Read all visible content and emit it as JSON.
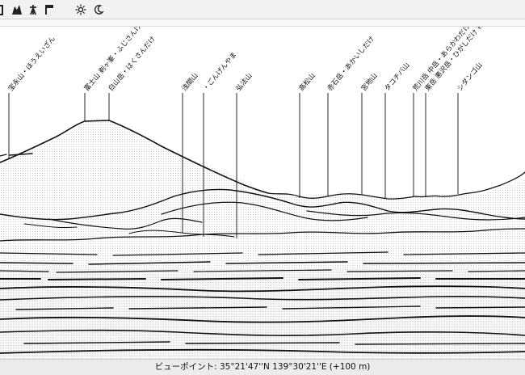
{
  "toolbar": {
    "buttons": [
      {
        "id": "tb-partial",
        "icon": "partial-tool-icon"
      },
      {
        "id": "tb-mountain",
        "icon": "mountain-icon"
      },
      {
        "id": "tb-tower",
        "icon": "tower-icon"
      },
      {
        "id": "tb-flag",
        "icon": "flag-icon"
      },
      {
        "id": "tb-sun",
        "icon": "sun-icon"
      },
      {
        "id": "tb-moon",
        "icon": "moon-icon"
      }
    ]
  },
  "peaks": [
    {
      "name": "宝永山・ほうえいざん"
    },
    {
      "name": "富士山 剣ヶ峯・ふじさんけんがみね"
    },
    {
      "name": "白山岳・はくさんだけ"
    },
    {
      "name": "浅間山"
    },
    {
      "name": "・ごんげんやま"
    },
    {
      "name": "弘法山"
    },
    {
      "name": "高松山"
    },
    {
      "name": "赤石岳・あかいしだけ"
    },
    {
      "name": "宮地山"
    },
    {
      "name": "タコチバ山"
    },
    {
      "name": "荒川岳 中岳・あらかわだけ なかだけ"
    },
    {
      "name": "東岳 悪沢岳・ひがしだけ わるさわだけ"
    },
    {
      "name": "シダンゴ山"
    }
  ],
  "status": {
    "viewpoint": "ビューポイント: 35°21'47''N 139°30'21''E (+100 m)"
  }
}
